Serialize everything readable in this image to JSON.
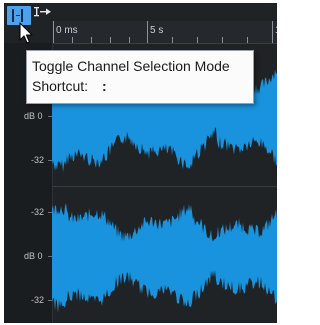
{
  "ruler": {
    "labels": [
      "0 ms",
      "5 s",
      "1"
    ]
  },
  "channels": [
    {
      "labels": [
        "dB 0",
        "-32"
      ]
    },
    {
      "labels": [
        "-32",
        "dB 0",
        "-32"
      ]
    }
  ],
  "tooltip": {
    "title": "Toggle Channel Selection Mode",
    "shortcut_label": "Shortcut:",
    "shortcut_value": ":"
  },
  "icons": {
    "toggle": "channel-selection-mode-icon",
    "small": "text-cursor-arrow-icon",
    "cursor": "mouse-pointer-icon"
  },
  "colors": {
    "waveform": "#1993dd",
    "panel": "#202326",
    "button": "#4aa3ec"
  }
}
